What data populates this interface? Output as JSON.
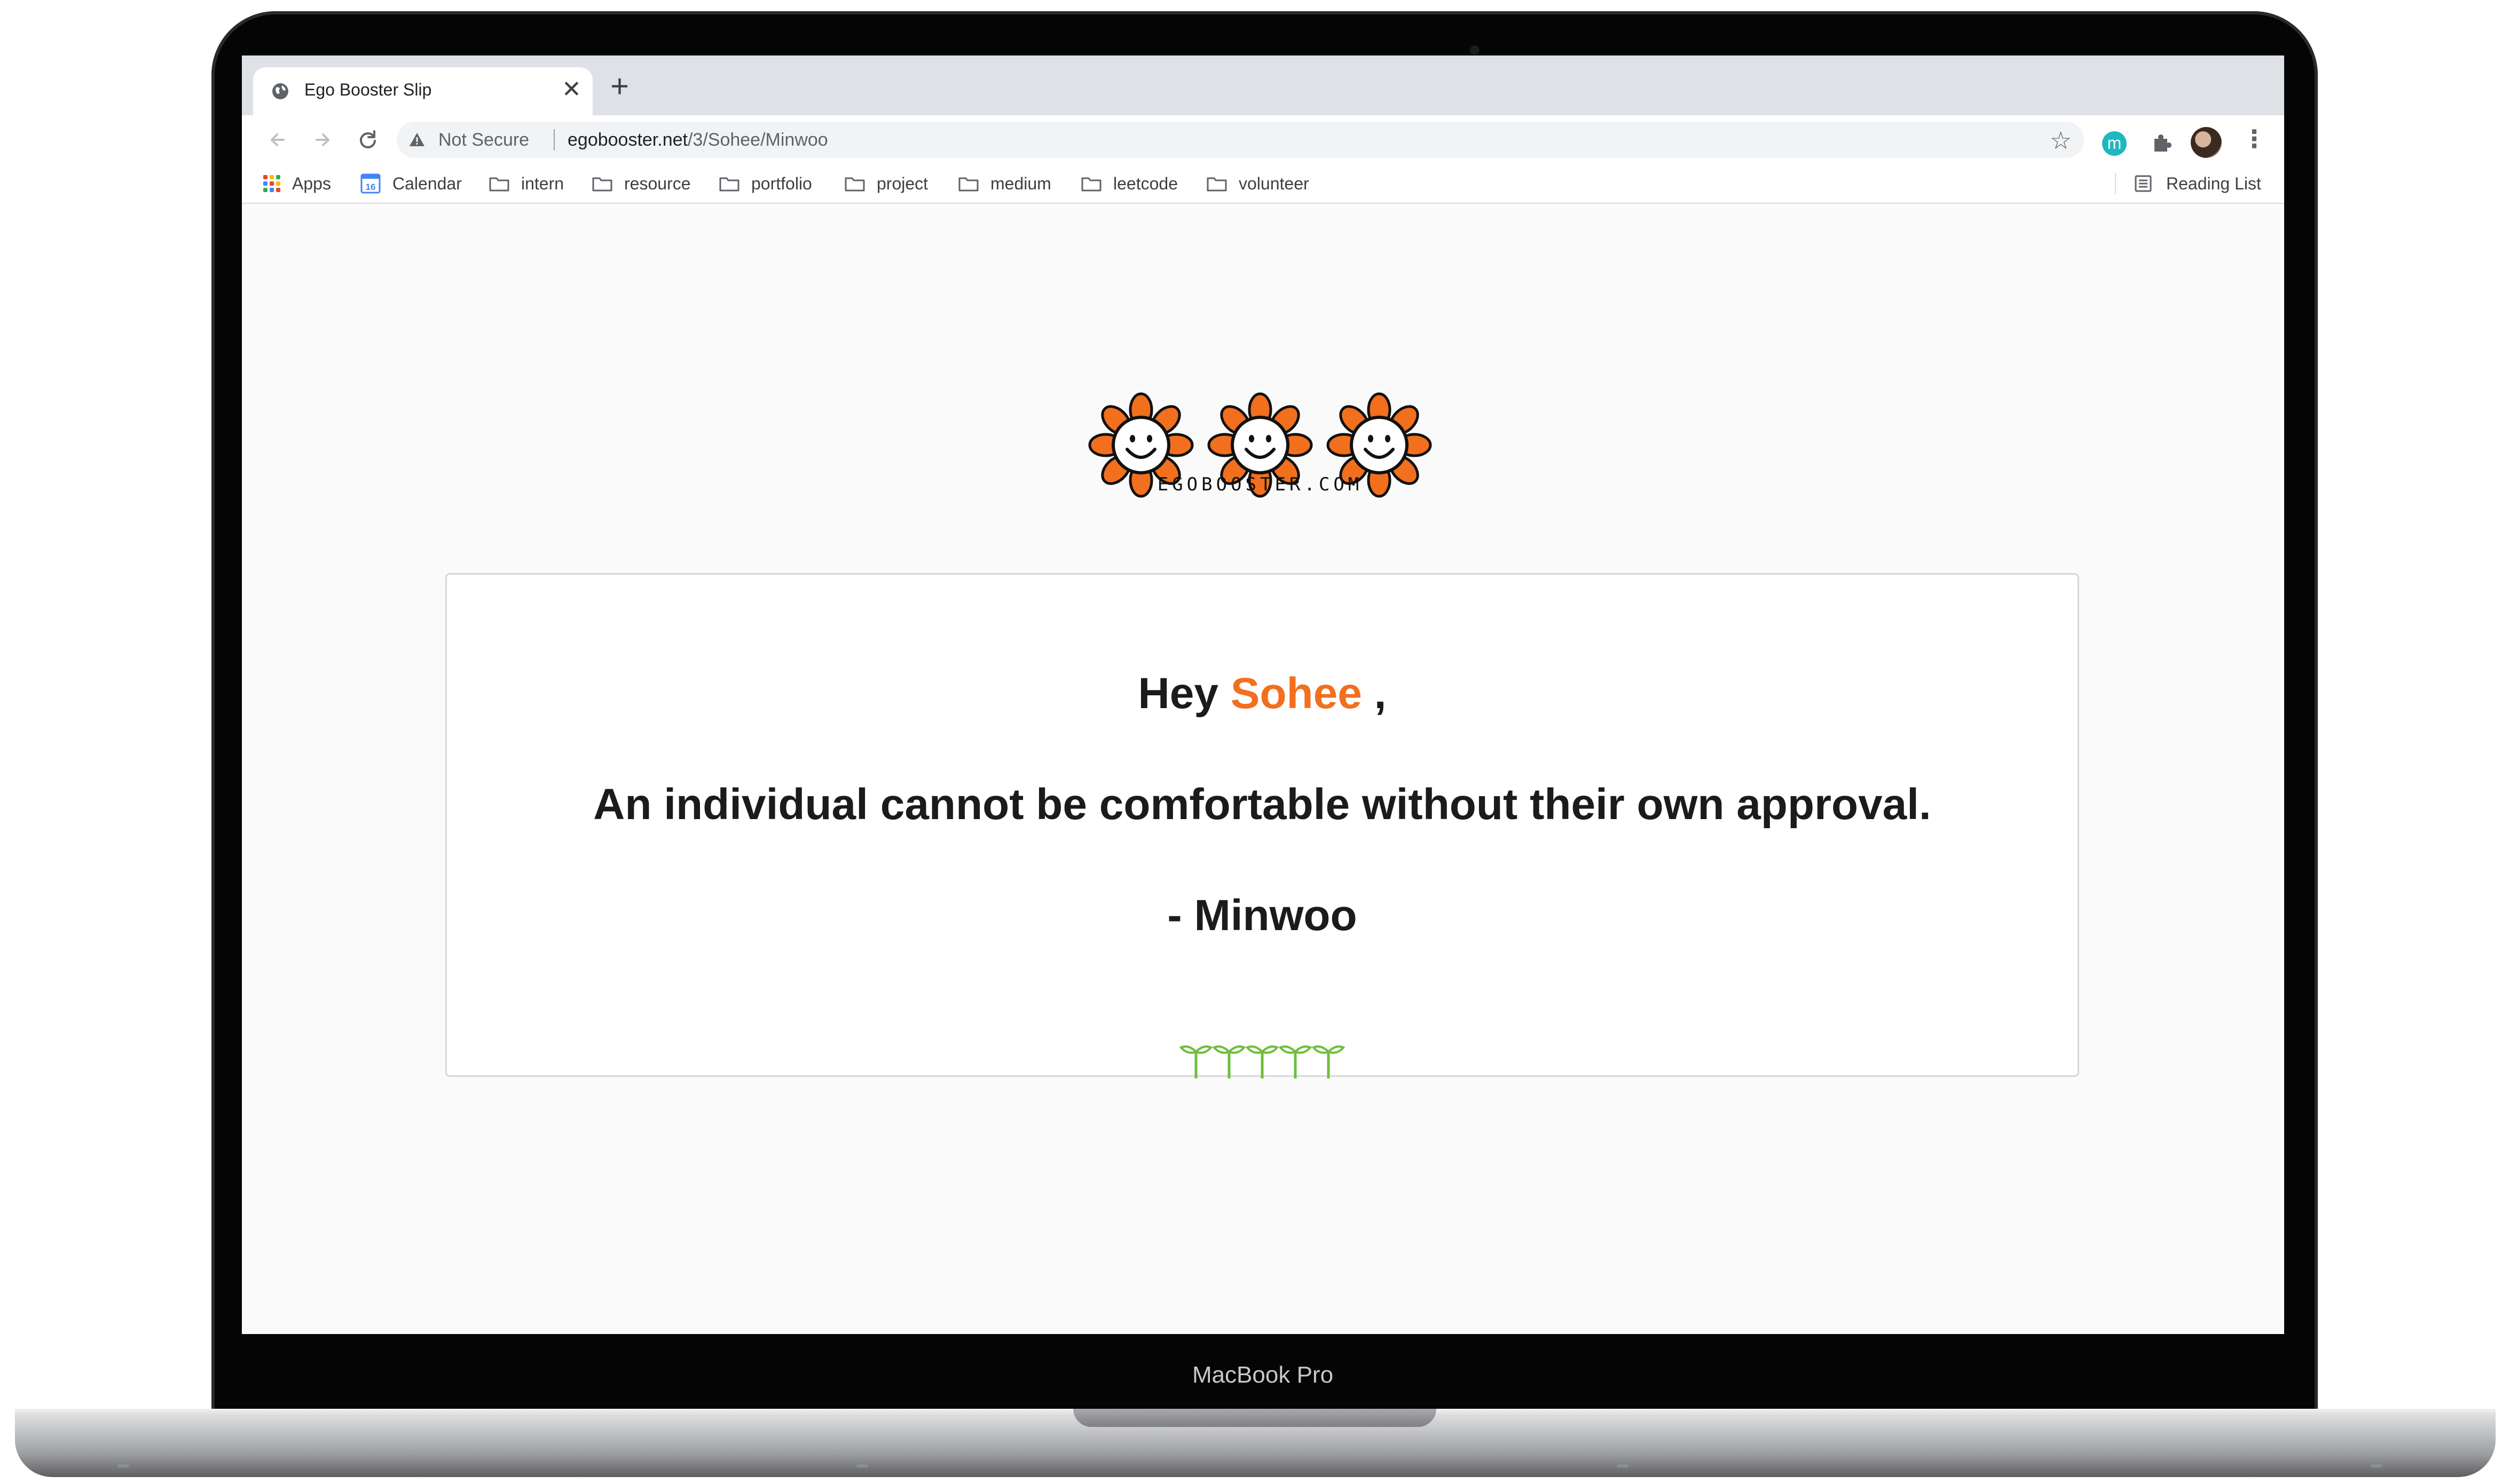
{
  "browser": {
    "tab_title": "Ego Booster Slip",
    "close_glyph": "✕",
    "new_tab_glyph": "+",
    "security_label": "Not Secure",
    "url_domain": "egobooster.net",
    "url_path": "/3/Sohee/Minwoo",
    "extension_label": "m",
    "bookmarks": [
      {
        "label": "Apps",
        "icon": "apps-grid-icon"
      },
      {
        "label": "Calendar",
        "icon": "calendar-icon"
      },
      {
        "label": "intern",
        "icon": "folder-icon"
      },
      {
        "label": "resource",
        "icon": "folder-icon"
      },
      {
        "label": "portfolio",
        "icon": "folder-icon"
      },
      {
        "label": "project",
        "icon": "folder-icon"
      },
      {
        "label": "medium",
        "icon": "folder-icon"
      },
      {
        "label": "leetcode",
        "icon": "folder-icon"
      },
      {
        "label": "volunteer",
        "icon": "folder-icon"
      }
    ],
    "reading_list": "Reading List",
    "calendar_day": "16"
  },
  "page": {
    "site_name": "EGOBOOSTER.COM",
    "greeting_prefix": "Hey ",
    "recipient": "Sohee",
    "greeting_suffix": " ,",
    "message": "An individual cannot be comfortable without their own approval.",
    "signature": "- Minwoo"
  },
  "device": {
    "model": "MacBook Pro"
  },
  "colors": {
    "accent_orange": "#f26f1e",
    "sprout_green": "#6cbf3a",
    "text_dark": "#1b1b1b"
  }
}
